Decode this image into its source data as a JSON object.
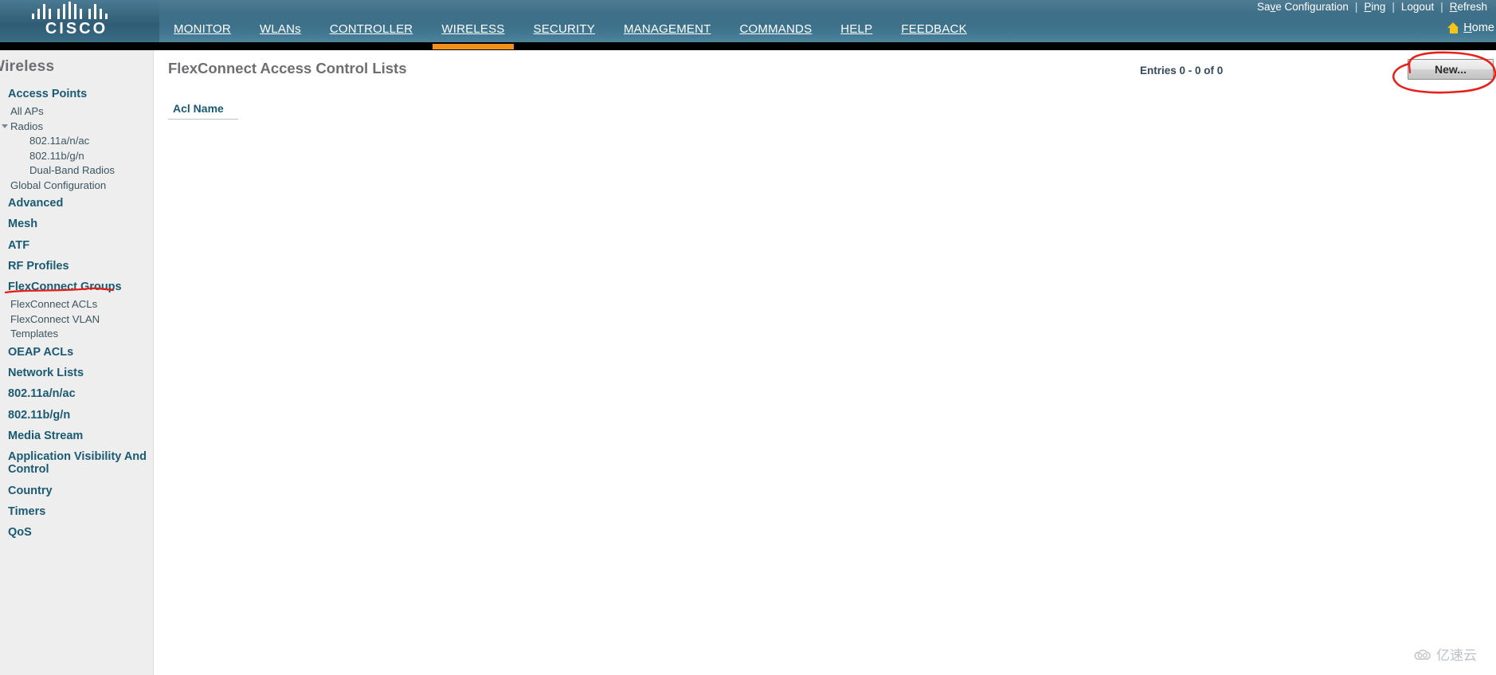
{
  "header": {
    "brand": "CISCO",
    "utility_links": [
      {
        "label": "Save Configuration",
        "accel": "v",
        "name": "save-configuration-link"
      },
      {
        "label": "Ping",
        "accel": "P",
        "name": "ping-link"
      },
      {
        "label": "Logout",
        "accel": "",
        "name": "logout-link"
      },
      {
        "label": "Refresh",
        "accel": "R",
        "name": "refresh-link"
      }
    ],
    "separator": "|",
    "home_label": "Home",
    "home_accel": "H",
    "home_icon": "home-icon",
    "nav_items": [
      {
        "label": "MONITOR",
        "accel": "M",
        "active": false,
        "name": "nav-monitor"
      },
      {
        "label": "WLANs",
        "accel": "W",
        "active": false,
        "name": "nav-wlans"
      },
      {
        "label": "CONTROLLER",
        "accel": "C",
        "active": false,
        "name": "nav-controller"
      },
      {
        "label": "WIRELESS",
        "accel": "I",
        "active": true,
        "name": "nav-wireless"
      },
      {
        "label": "SECURITY",
        "accel": "S",
        "active": false,
        "name": "nav-security"
      },
      {
        "label": "MANAGEMENT",
        "accel": "A",
        "active": false,
        "name": "nav-management"
      },
      {
        "label": "COMMANDS",
        "accel": "O",
        "active": false,
        "name": "nav-commands"
      },
      {
        "label": "HELP",
        "accel": "L",
        "active": false,
        "name": "nav-help"
      },
      {
        "label": "FEEDBACK",
        "accel": "F",
        "active": false,
        "name": "nav-feedback"
      }
    ]
  },
  "sidebar": {
    "title": "Wireless",
    "items": [
      {
        "label": "Access Points",
        "type": "group",
        "name": "sidebar-access-points"
      },
      {
        "label": "All APs",
        "type": "child",
        "name": "sidebar-all-aps"
      },
      {
        "label": "Radios",
        "type": "child",
        "caret": true,
        "name": "sidebar-radios"
      },
      {
        "label": "802.11a/n/ac",
        "type": "child2",
        "name": "sidebar-radios-802-11a-n-ac"
      },
      {
        "label": "802.11b/g/n",
        "type": "child2",
        "name": "sidebar-radios-802-11b-g-n"
      },
      {
        "label": "Dual-Band Radios",
        "type": "child2",
        "name": "sidebar-dual-band-radios"
      },
      {
        "label": "Global Configuration",
        "type": "child",
        "name": "sidebar-global-configuration"
      },
      {
        "label": "Advanced",
        "type": "group",
        "name": "sidebar-advanced"
      },
      {
        "label": "Mesh",
        "type": "group",
        "name": "sidebar-mesh"
      },
      {
        "label": "ATF",
        "type": "group",
        "name": "sidebar-atf"
      },
      {
        "label": "RF Profiles",
        "type": "group",
        "name": "sidebar-rf-profiles"
      },
      {
        "label": "FlexConnect Groups",
        "type": "group",
        "name": "sidebar-flexconnect-groups"
      },
      {
        "label": "FlexConnect ACLs",
        "type": "child",
        "name": "sidebar-flexconnect-acls"
      },
      {
        "label": "FlexConnect VLAN",
        "type": "child",
        "name": "sidebar-flexconnect-vlan"
      },
      {
        "label": "Templates",
        "type": "child",
        "name": "sidebar-templates"
      },
      {
        "label": "OEAP ACLs",
        "type": "group",
        "name": "sidebar-oeap-acls"
      },
      {
        "label": "Network Lists",
        "type": "group",
        "name": "sidebar-network-lists"
      },
      {
        "label": "802.11a/n/ac",
        "type": "group",
        "name": "sidebar-802-11a-n-ac"
      },
      {
        "label": "802.11b/g/n",
        "type": "group",
        "name": "sidebar-802-11b-g-n"
      },
      {
        "label": "Media Stream",
        "type": "group",
        "name": "sidebar-media-stream"
      },
      {
        "label": "Application Visibility And Control",
        "type": "group",
        "name": "sidebar-application-visibility-and-control"
      },
      {
        "label": "Country",
        "type": "group",
        "name": "sidebar-country"
      },
      {
        "label": "Timers",
        "type": "group",
        "name": "sidebar-timers"
      },
      {
        "label": "QoS",
        "type": "group",
        "name": "sidebar-qos"
      }
    ]
  },
  "main": {
    "page_title": "FlexConnect Access Control Lists",
    "entries_text": "Entries 0 - 0 of 0",
    "new_button_label": "New...",
    "table": {
      "columns": [
        "Acl Name"
      ],
      "rows": []
    }
  },
  "annotations": {
    "accent_orange": "#f39019",
    "marker_red": "#e8201a",
    "new_button_circled": true,
    "sidebar_underline_target": "FlexConnect ACLs"
  },
  "watermark": {
    "text": "亿速云",
    "icon": "cloud-icon"
  }
}
